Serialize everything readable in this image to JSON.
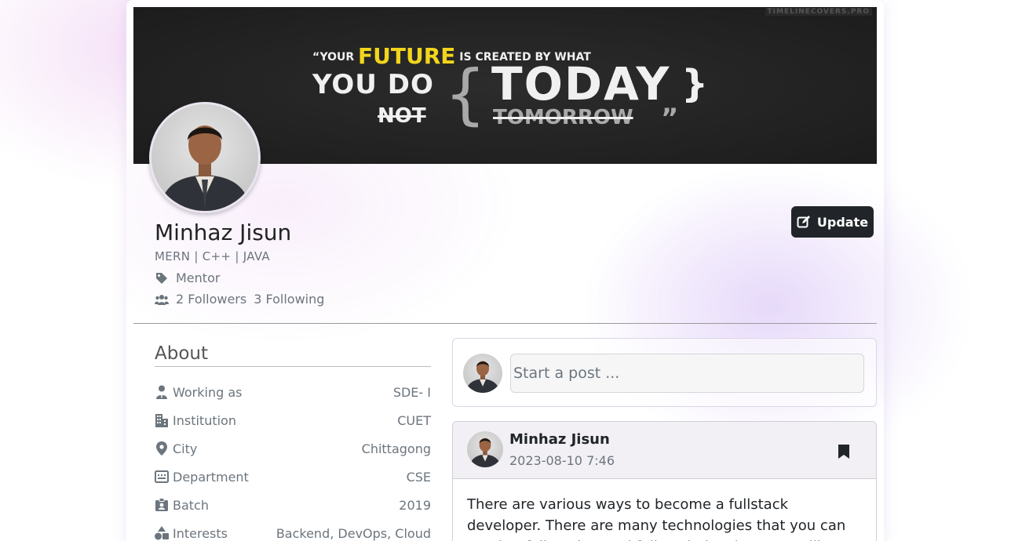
{
  "cover": {
    "watermark": "TIMELINECOVERS.PRO",
    "quote_open": "“YOUR",
    "quote_future": "FUTURE",
    "quote_rest1": "IS CREATED BY WHAT",
    "quote_line2": "YOU DO",
    "quote_not": "NOT",
    "quote_today": "TODAY",
    "quote_tomorrow": "TOMORROW",
    "quote_close": "”"
  },
  "profile": {
    "name": "Minhaz Jisun",
    "tagline": "MERN | C++ | JAVA",
    "role": "Mentor",
    "followers": "2 Followers",
    "following": "3 Following",
    "update_label": "Update"
  },
  "about": {
    "title": "About",
    "rows": [
      {
        "icon": "person-tie-icon",
        "label": "Working as",
        "value": "SDE- I"
      },
      {
        "icon": "building-icon",
        "label": "Institution",
        "value": "CUET"
      },
      {
        "icon": "location-pin-icon",
        "label": "City",
        "value": "Chittagong"
      },
      {
        "icon": "department-icon",
        "label": "Department",
        "value": "CSE"
      },
      {
        "icon": "id-badge-icon",
        "label": "Batch",
        "value": "2019"
      },
      {
        "icon": "shapes-icon",
        "label": "Interests",
        "value": "Backend, DevOps, Cloud"
      }
    ]
  },
  "composer": {
    "placeholder": "Start a post ..."
  },
  "post": {
    "author": "Minhaz Jisun",
    "timestamp": "2023-08-10 7:46",
    "body": "There are various ways to become a fullstack developer. There are many technologies that you can need to follow that and fullstack development will"
  },
  "colors": {
    "cover_bg": "#1e1e1e",
    "accent_yellow": "#f2d51d",
    "button_dark": "#212529",
    "muted_text": "#6c757d"
  }
}
